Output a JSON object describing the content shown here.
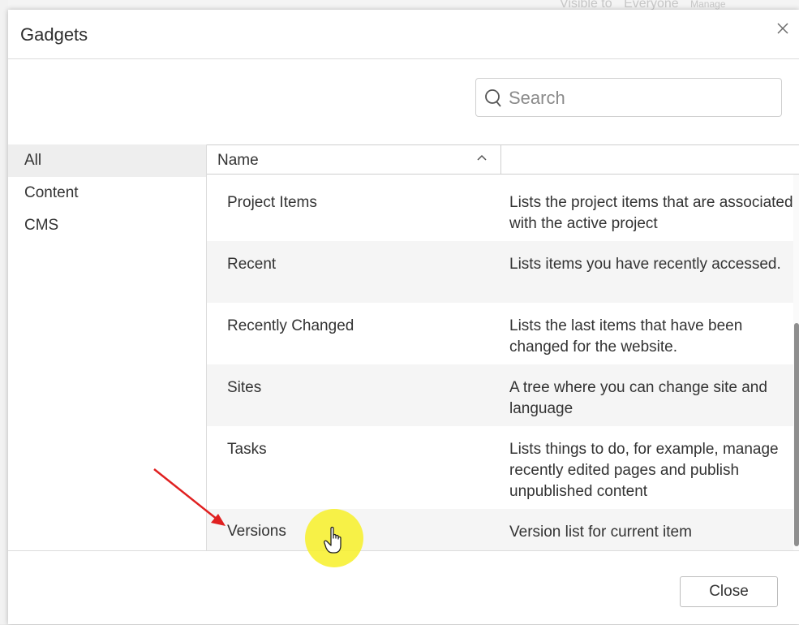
{
  "background": {
    "visible_to_label": "Visible to",
    "everyone_label": "Everyone",
    "manage_label": "Manage"
  },
  "dialog": {
    "title": "Gadgets",
    "close_icon": "close-icon"
  },
  "search": {
    "placeholder": "Search",
    "value": "",
    "icon": "search-icon"
  },
  "categories": [
    {
      "label": "All",
      "active": true
    },
    {
      "label": "Content",
      "active": false
    },
    {
      "label": "CMS",
      "active": false
    }
  ],
  "table": {
    "columns": [
      {
        "label": "Name",
        "sort": "ascending"
      },
      {
        "label": ""
      }
    ],
    "rows": [
      {
        "name": "Project Items",
        "description": "Lists the project items that are associated with the active project"
      },
      {
        "name": "Recent",
        "description": "Lists items you have recently accessed."
      },
      {
        "name": "Recently Changed",
        "description": "Lists the last items that have been changed for the website."
      },
      {
        "name": "Sites",
        "description": "A tree where you can change site and language"
      },
      {
        "name": "Tasks",
        "description": "Lists things to do, for example, manage recently edited pages and publish unpublished content"
      },
      {
        "name": "Versions",
        "description": "Version list for current item"
      }
    ]
  },
  "footer": {
    "close_label": "Close"
  },
  "colors": {
    "row_alt": "#f5f5f5",
    "annotation_arrow": "#e02020",
    "cursor_highlight": "#f7f028"
  }
}
